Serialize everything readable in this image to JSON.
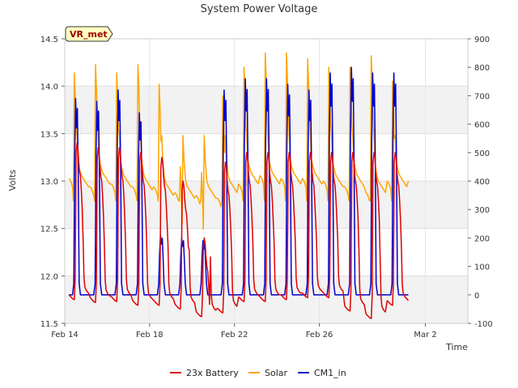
{
  "chart_data": {
    "type": "line",
    "title": "System Power Voltage",
    "xlabel": "Time",
    "ylabel": "Volts",
    "badge": "VR_met",
    "x_range": [
      "2024-02-14",
      "2024-03-04"
    ],
    "x_ticks": [
      {
        "date": "2024-02-14",
        "label": "Feb 14"
      },
      {
        "date": "2024-02-18",
        "label": "Feb 18"
      },
      {
        "date": "2024-02-22",
        "label": "Feb 22"
      },
      {
        "date": "2024-02-26",
        "label": "Feb 26"
      },
      {
        "date": "2024-03-02",
        "label": "Mar 2"
      }
    ],
    "y_left": {
      "range": [
        11.5,
        14.5
      ],
      "ticks": [
        "11.5",
        "12.0",
        "12.5",
        "13.0",
        "13.5",
        "14.0",
        "14.5"
      ]
    },
    "y_right": {
      "range": [
        -100,
        900
      ],
      "ticks": [
        "-100",
        "0",
        "100",
        "200",
        "300",
        "400",
        "500",
        "600",
        "700",
        "800",
        "900"
      ]
    },
    "grid": true,
    "legend_position": "bottom",
    "series": [
      {
        "name": "23x Battery",
        "axis": "left",
        "color": "#e00000",
        "night_values": [
          11.78,
          11.75,
          11.76,
          11.72,
          11.72,
          11.68,
          11.6,
          11.64,
          11.76,
          11.76,
          11.78,
          11.8,
          11.8,
          11.66,
          11.58,
          11.72
        ],
        "peak_values": [
          13.4,
          13.35,
          13.35,
          13.3,
          13.25,
          13.0,
          12.4,
          13.2,
          13.3,
          13.3,
          13.3,
          13.3,
          13.3,
          13.3,
          13.3,
          13.3
        ]
      },
      {
        "name": "Solar",
        "axis": "right",
        "color": "#ffa500",
        "day_start": [
          410,
          380,
          390,
          380,
          380,
          360,
          350,
          340,
          390,
          420,
          410,
          410,
          400,
          380,
          360,
          400
        ],
        "peak_values": [
          780,
          810,
          780,
          810,
          740,
          450,
          430,
          700,
          800,
          850,
          850,
          830,
          800,
          800,
          840,
          750
        ],
        "late_values": [
          420,
          430,
          420,
          410,
          390,
          380,
          380,
          400,
          430,
          430,
          430,
          430,
          420,
          420,
          400,
          420
        ]
      },
      {
        "name": "CM1_in",
        "axis": "right",
        "color": "#0000cc",
        "night_value": 0,
        "peak_values": [
          690,
          680,
          720,
          640,
          210,
          200,
          190,
          720,
          760,
          760,
          740,
          720,
          780,
          800,
          780,
          780
        ]
      }
    ]
  }
}
